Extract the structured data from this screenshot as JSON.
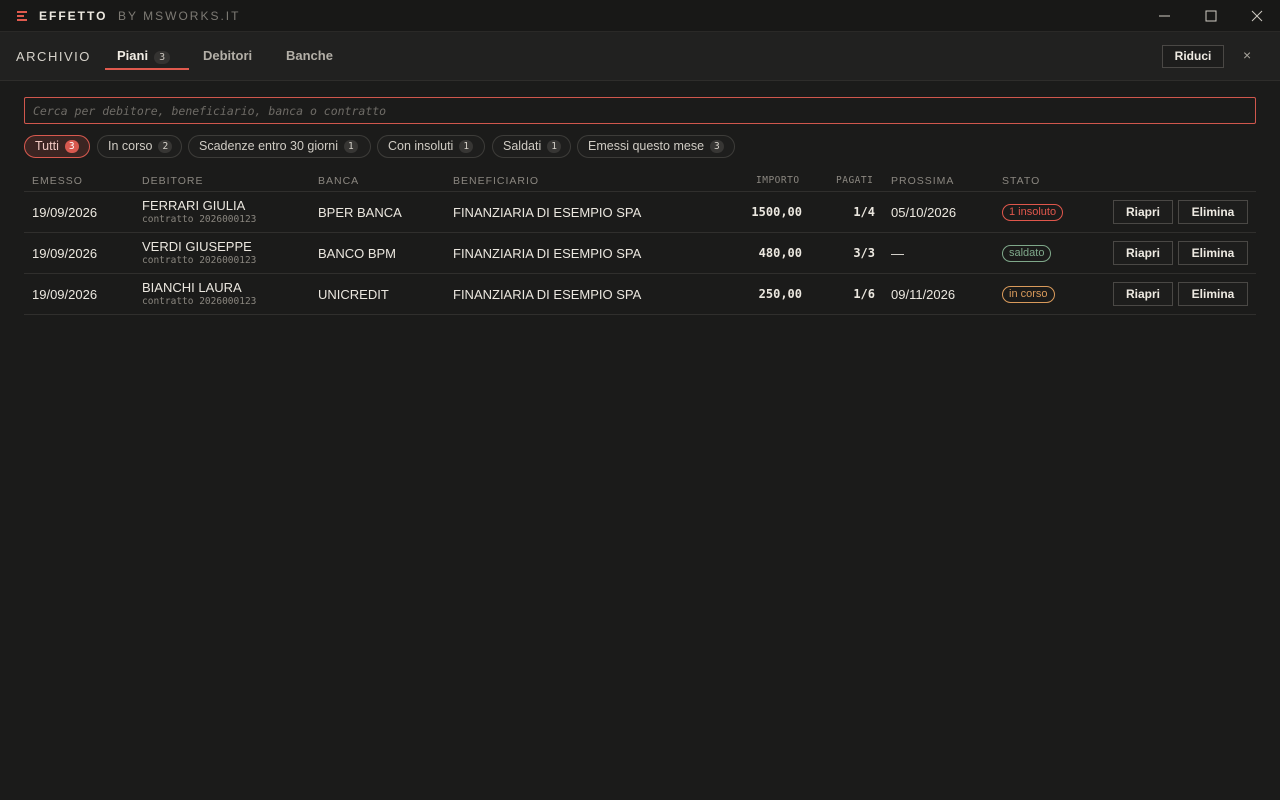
{
  "window": {
    "app_name": "EFFETTO",
    "app_by": "BY MSWORKS.IT"
  },
  "header": {
    "section": "ARCHIVIO",
    "tabs": [
      {
        "label": "Piani",
        "count": "3",
        "active": true
      },
      {
        "label": "Debitori"
      },
      {
        "label": "Banche"
      }
    ],
    "collapse_label": "Riduci",
    "close_label": "×"
  },
  "search": {
    "placeholder": "Cerca per debitore, beneficiario, banca o contratto",
    "value": ""
  },
  "filters": [
    {
      "label": "Tutti",
      "count": "3",
      "active": true
    },
    {
      "label": "In corso",
      "count": "2"
    },
    {
      "label": "Scadenze entro 30 giorni",
      "count": "1"
    },
    {
      "label": "Con insoluti",
      "count": "1"
    },
    {
      "label": "Saldati",
      "count": "1"
    },
    {
      "label": "Emessi questo mese",
      "count": "3"
    }
  ],
  "table": {
    "columns": {
      "emesso": "EMESSO",
      "debitore": "DEBITORE",
      "banca": "BANCA",
      "beneficiario": "BENEFICIARIO",
      "importo": "IMPORTO",
      "pagati": "PAGATI",
      "prossima": "PROSSIMA",
      "stato": "STATO"
    },
    "rows": [
      {
        "emesso": "19/09/2026",
        "debitore": "FERRARI GIULIA",
        "contratto": "contratto 2026000123",
        "banca": "BPER BANCA",
        "beneficiario": "FINANZIARIA DI ESEMPIO SPA",
        "importo": "1500,00",
        "pagati": "1/4",
        "prossima": "05/10/2026",
        "stato": "1 insoluto",
        "stato_color": "#e0574c",
        "reopen_label": "Riapri",
        "delete_label": "Elimina"
      },
      {
        "emesso": "19/09/2026",
        "debitore": "VERDI GIUSEPPE",
        "contratto": "contratto 2026000123",
        "banca": "BANCO BPM",
        "beneficiario": "FINANZIARIA DI ESEMPIO SPA",
        "importo": "480,00",
        "pagati": "3/3",
        "prossima": "—",
        "stato": "saldato",
        "stato_color": "#7fa88a",
        "reopen_label": "Riapri",
        "delete_label": "Elimina"
      },
      {
        "emesso": "19/09/2026",
        "debitore": "BIANCHI LAURA",
        "contratto": "contratto 2026000123",
        "banca": "UNICREDIT",
        "beneficiario": "FINANZIARIA DI ESEMPIO SPA",
        "importo": "250,00",
        "pagati": "1/6",
        "prossima": "09/11/2026",
        "stato": "in corso",
        "stato_color": "#d99a5b",
        "reopen_label": "Riapri",
        "delete_label": "Elimina"
      }
    ]
  },
  "colors": {
    "accent": "#e05a4e",
    "background": "#1b1b1a"
  }
}
